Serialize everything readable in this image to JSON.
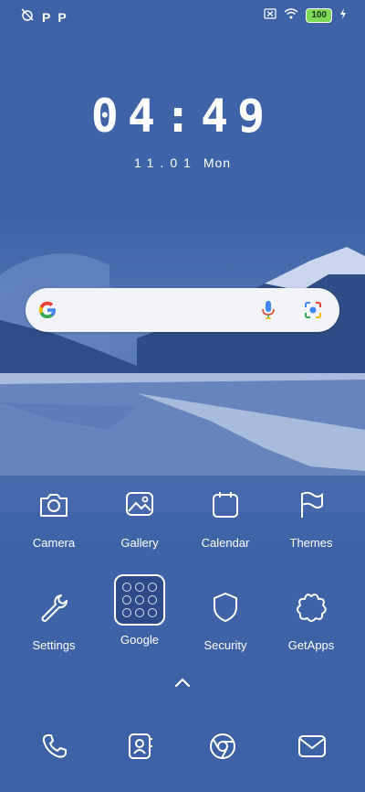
{
  "status_bar": {
    "left_icons": [
      "alarm-off-icon",
      "p-icon",
      "p-icon"
    ],
    "p_label": "P",
    "right_icons": [
      "no-sim-icon",
      "wifi-icon",
      "battery-icon",
      "charging-icon"
    ],
    "battery": "100"
  },
  "lock_clock": {
    "time": "04:49",
    "date": "11.01",
    "weekday": "Mon"
  },
  "search_bar": {
    "icons": [
      "google-g-icon",
      "mic-icon",
      "lens-icon"
    ]
  },
  "apps": [
    {
      "label": "Camera",
      "icon": "camera-icon"
    },
    {
      "label": "Gallery",
      "icon": "gallery-icon"
    },
    {
      "label": "Calendar",
      "icon": "calendar-icon"
    },
    {
      "label": "Themes",
      "icon": "flag-icon"
    },
    {
      "label": "Settings",
      "icon": "wrench-icon"
    },
    {
      "label": "Google",
      "icon": "folder-icon"
    },
    {
      "label": "Security",
      "icon": "shield-icon"
    },
    {
      "label": "GetApps",
      "icon": "flower-icon"
    }
  ],
  "dock": [
    "phone-icon",
    "contacts-icon",
    "browser-icon",
    "messages-icon"
  ],
  "colors": {
    "background": "#3e63a7",
    "battery": "#7ed957"
  }
}
